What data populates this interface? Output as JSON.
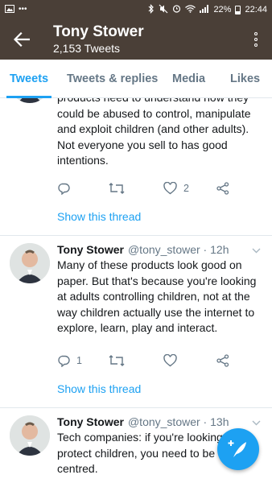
{
  "status_bar": {
    "battery": "22%",
    "time": "22:44"
  },
  "header": {
    "name": "Tony Stower",
    "tweet_count": "2,153 Tweets"
  },
  "tabs": [
    {
      "label": "Tweets",
      "active": true
    },
    {
      "label": "Tweets & replies",
      "active": false
    },
    {
      "label": "Media",
      "active": false
    },
    {
      "label": "Likes",
      "active": false
    }
  ],
  "tweets": [
    {
      "text": "products need to understand how they could be abused to control, manipulate and exploit children (and other adults). Not everyone you sell to has good intentions.",
      "reply_count": "",
      "retweet_count": "",
      "like_count": "2",
      "thread_link": "Show this thread"
    },
    {
      "name": "Tony Stower",
      "handle": "@tony_stower",
      "time": "12h",
      "text": "Many of these products look good on paper. But that's because you're looking at adults controlling children, not at the way children actually use the internet to explore, learn, play and interact.",
      "reply_count": "1",
      "retweet_count": "",
      "like_count": "",
      "thread_link": "Show this thread"
    },
    {
      "name": "Tony Stower",
      "handle": "@tony_stower",
      "time": "13h",
      "text": "Tech companies: if you're looking to protect children, you need to be CHILD-centred."
    }
  ],
  "colors": {
    "bar": "#4a3f37",
    "accent": "#1da1f2",
    "muted": "#657786"
  }
}
